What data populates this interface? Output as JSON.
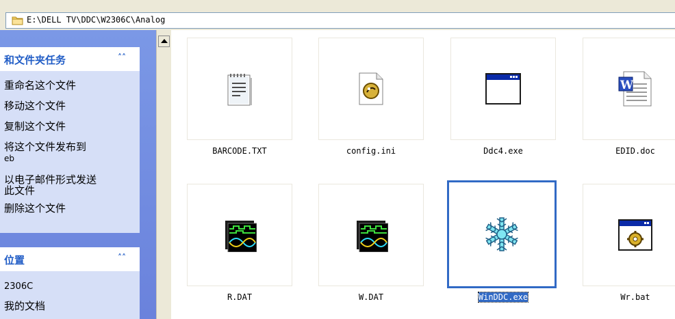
{
  "address": {
    "path": "E:\\DELL TV\\DDC\\W2306C\\Analog"
  },
  "sidebar": {
    "tasks_title": "和文件夹任务",
    "tasks_items": [
      "重命名这个文件",
      "移动这个文件",
      "复制这个文件",
      "将这个文件发布到",
      "eb",
      "以电子邮件形式发送",
      "此文件",
      "删除这个文件"
    ],
    "places_title": "位置",
    "places_items": [
      "2306C",
      "我的文档"
    ]
  },
  "files": [
    {
      "name": "BARCODE.TXT",
      "icon": "text-file-icon"
    },
    {
      "name": "config.ini",
      "icon": "config-file-icon"
    },
    {
      "name": "Ddc4.exe",
      "icon": "application-window-icon"
    },
    {
      "name": "EDID.doc",
      "icon": "word-document-icon"
    },
    {
      "name": "R.DAT",
      "icon": "data-wave-icon"
    },
    {
      "name": "W.DAT",
      "icon": "data-wave-icon"
    },
    {
      "name": "WinDDC.exe",
      "icon": "snowflake-icon"
    },
    {
      "name": "Wr.bat",
      "icon": "batch-file-gear-icon"
    }
  ],
  "colors": {
    "accent": "#316ac5",
    "sidebar_bg": "#6a82dc",
    "panel_body": "#d6dff7"
  }
}
